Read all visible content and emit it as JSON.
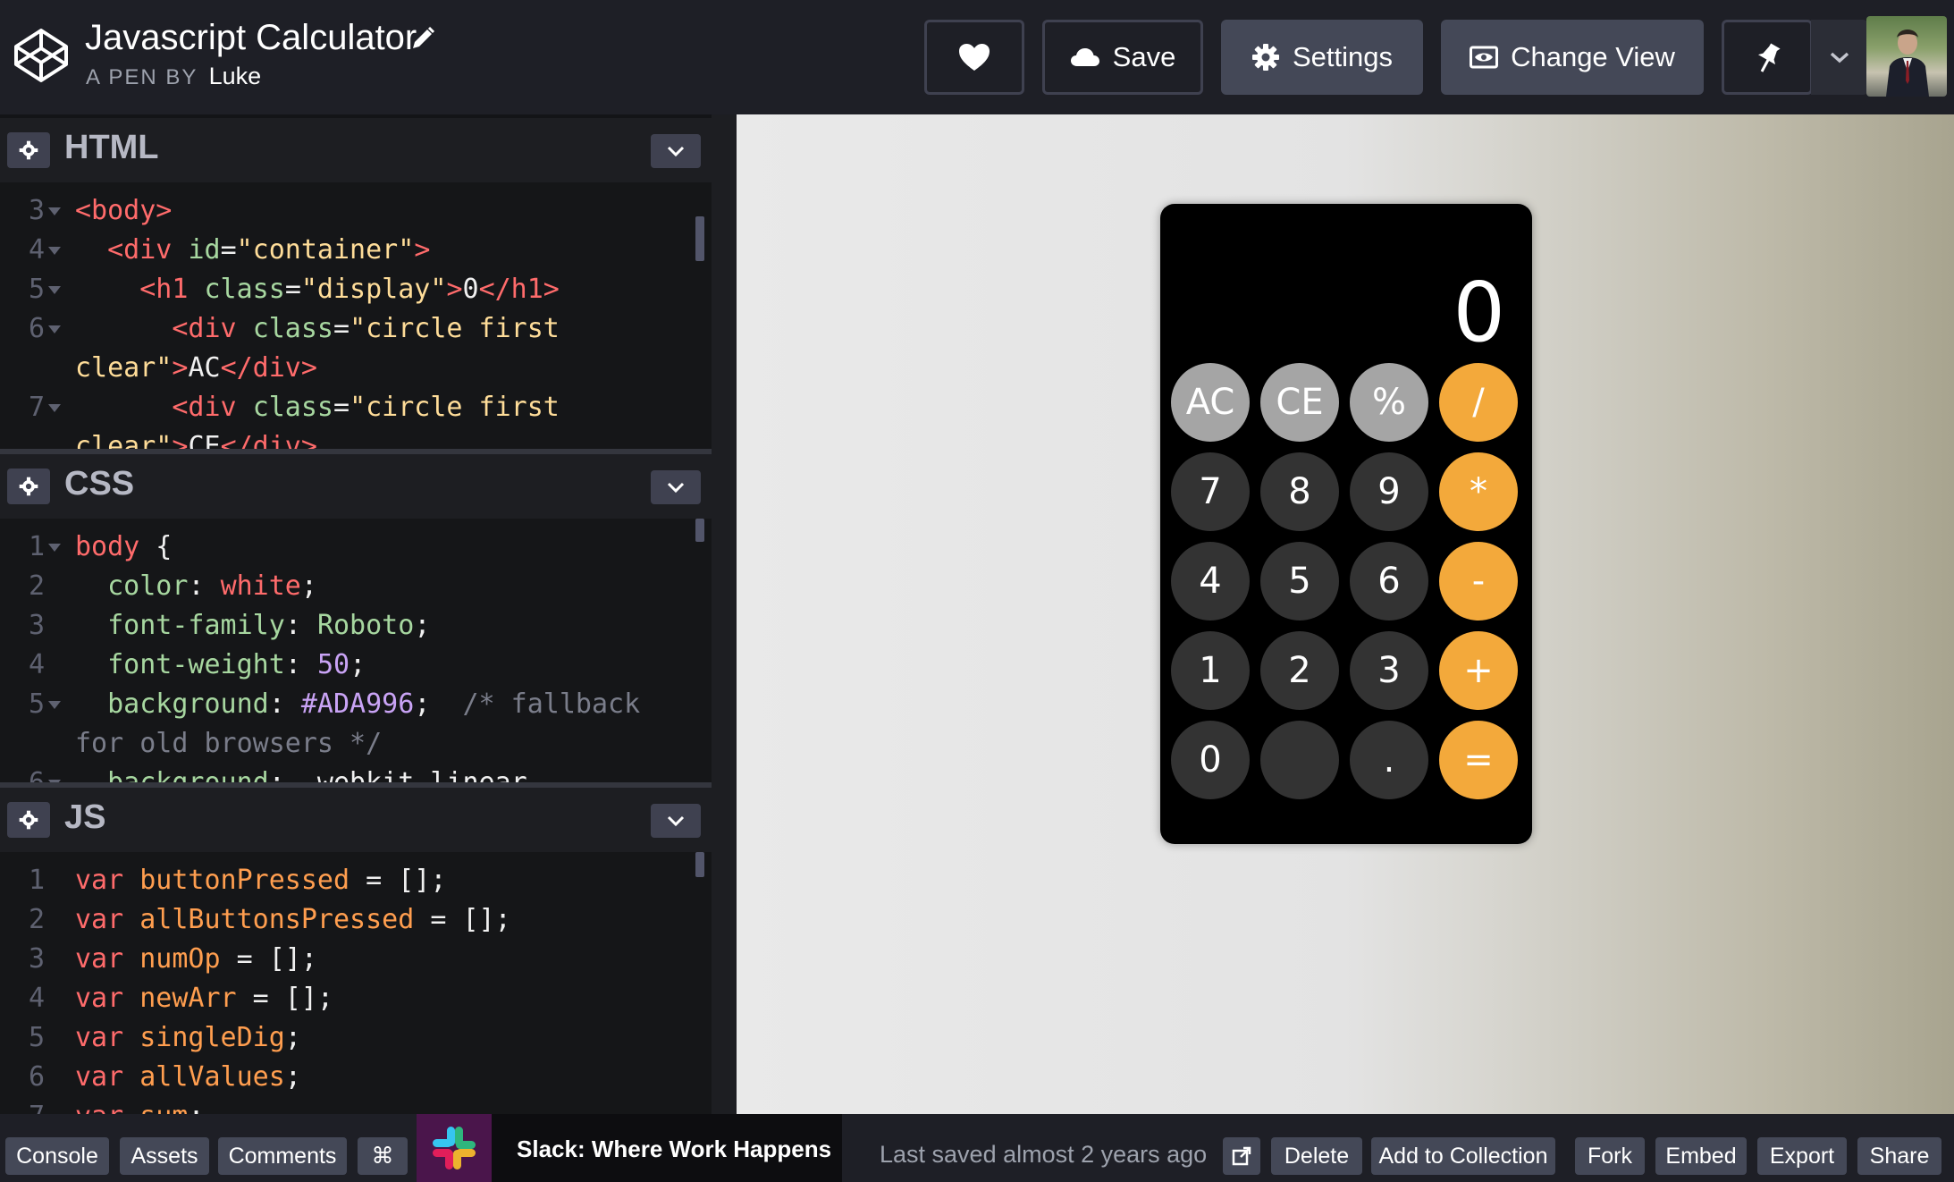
{
  "header": {
    "title": "Javascript Calculator",
    "byline_prefix": "A PEN BY",
    "author": "Luke",
    "save_label": "Save",
    "settings_label": "Settings",
    "change_view_label": "Change View"
  },
  "panels": {
    "html": {
      "title": "HTML",
      "lines": [
        {
          "n": "3",
          "fold": true,
          "parts": [
            {
              "c": "tag",
              "t": "<body>"
            }
          ]
        },
        {
          "n": "4",
          "fold": true,
          "parts": [
            {
              "c": "plain",
              "t": "  "
            },
            {
              "c": "tag",
              "t": "<div "
            },
            {
              "c": "attr",
              "t": "id"
            },
            {
              "c": "plain",
              "t": "="
            },
            {
              "c": "str",
              "t": "\"container\""
            },
            {
              "c": "tag",
              "t": ">"
            }
          ]
        },
        {
          "n": "5",
          "fold": true,
          "parts": [
            {
              "c": "plain",
              "t": "    "
            },
            {
              "c": "tag",
              "t": "<h1 "
            },
            {
              "c": "attr",
              "t": "class"
            },
            {
              "c": "plain",
              "t": "="
            },
            {
              "c": "str",
              "t": "\"display\""
            },
            {
              "c": "tag",
              "t": ">"
            },
            {
              "c": "plain",
              "t": "0"
            },
            {
              "c": "tag",
              "t": "</h1>"
            }
          ]
        },
        {
          "n": "6",
          "fold": true,
          "parts": [
            {
              "c": "plain",
              "t": "      "
            },
            {
              "c": "tag",
              "t": "<div "
            },
            {
              "c": "attr",
              "t": "class"
            },
            {
              "c": "plain",
              "t": "="
            },
            {
              "c": "str",
              "t": "\"circle first"
            }
          ]
        },
        {
          "n": "",
          "fold": false,
          "parts": [
            {
              "c": "str",
              "t": "clear\""
            },
            {
              "c": "tag",
              "t": ">"
            },
            {
              "c": "plain",
              "t": "AC"
            },
            {
              "c": "tag",
              "t": "</div>"
            }
          ]
        },
        {
          "n": "7",
          "fold": true,
          "parts": [
            {
              "c": "plain",
              "t": "      "
            },
            {
              "c": "tag",
              "t": "<div "
            },
            {
              "c": "attr",
              "t": "class"
            },
            {
              "c": "plain",
              "t": "="
            },
            {
              "c": "str",
              "t": "\"circle first"
            }
          ]
        },
        {
          "n": "",
          "fold": false,
          "parts": [
            {
              "c": "str",
              "t": "clear\""
            },
            {
              "c": "tag",
              "t": ">"
            },
            {
              "c": "plain",
              "t": "CE"
            },
            {
              "c": "tag",
              "t": "</div>"
            }
          ]
        }
      ]
    },
    "css": {
      "title": "CSS",
      "lines": [
        {
          "n": "1",
          "fold": true,
          "parts": [
            {
              "c": "sel",
              "t": "body"
            },
            {
              "c": "plain",
              "t": " {"
            }
          ]
        },
        {
          "n": "2",
          "fold": false,
          "parts": [
            {
              "c": "plain",
              "t": "  "
            },
            {
              "c": "prop",
              "t": "color"
            },
            {
              "c": "plain",
              "t": ": "
            },
            {
              "c": "val",
              "t": "white"
            },
            {
              "c": "plain",
              "t": ";"
            }
          ]
        },
        {
          "n": "3",
          "fold": false,
          "parts": [
            {
              "c": "plain",
              "t": "  "
            },
            {
              "c": "prop",
              "t": "font-family"
            },
            {
              "c": "plain",
              "t": ": "
            },
            {
              "c": "attr",
              "t": "Roboto"
            },
            {
              "c": "plain",
              "t": ";"
            }
          ]
        },
        {
          "n": "4",
          "fold": false,
          "parts": [
            {
              "c": "plain",
              "t": "  "
            },
            {
              "c": "prop",
              "t": "font-weight"
            },
            {
              "c": "plain",
              "t": ": "
            },
            {
              "c": "num",
              "t": "50"
            },
            {
              "c": "plain",
              "t": ";"
            }
          ]
        },
        {
          "n": "5",
          "fold": true,
          "parts": [
            {
              "c": "plain",
              "t": "  "
            },
            {
              "c": "prop",
              "t": "background"
            },
            {
              "c": "plain",
              "t": ": "
            },
            {
              "c": "hex",
              "t": "#ADA996"
            },
            {
              "c": "plain",
              "t": ";  "
            },
            {
              "c": "cmt",
              "t": "/* fallback"
            }
          ]
        },
        {
          "n": "",
          "fold": false,
          "parts": [
            {
              "c": "cmt",
              "t": "for old browsers */"
            }
          ]
        },
        {
          "n": "6",
          "fold": true,
          "parts": [
            {
              "c": "plain",
              "t": "  "
            },
            {
              "c": "prop",
              "t": "background"
            },
            {
              "c": "plain",
              "t": ": -webkit-linear-"
            }
          ]
        }
      ]
    },
    "js": {
      "title": "JS",
      "lines": [
        {
          "n": "1",
          "fold": false,
          "parts": [
            {
              "c": "kw",
              "t": "var "
            },
            {
              "c": "var",
              "t": "buttonPressed"
            },
            {
              "c": "op",
              "t": " = [];"
            }
          ]
        },
        {
          "n": "2",
          "fold": false,
          "parts": [
            {
              "c": "kw",
              "t": "var "
            },
            {
              "c": "var",
              "t": "allButtonsPressed"
            },
            {
              "c": "op",
              "t": " = [];"
            }
          ]
        },
        {
          "n": "3",
          "fold": false,
          "parts": [
            {
              "c": "kw",
              "t": "var "
            },
            {
              "c": "var",
              "t": "numOp"
            },
            {
              "c": "op",
              "t": " = [];"
            }
          ]
        },
        {
          "n": "4",
          "fold": false,
          "parts": [
            {
              "c": "kw",
              "t": "var "
            },
            {
              "c": "var",
              "t": "newArr"
            },
            {
              "c": "op",
              "t": " = [];"
            }
          ]
        },
        {
          "n": "5",
          "fold": false,
          "parts": [
            {
              "c": "kw",
              "t": "var "
            },
            {
              "c": "var",
              "t": "singleDig"
            },
            {
              "c": "op",
              "t": ";"
            }
          ]
        },
        {
          "n": "6",
          "fold": false,
          "parts": [
            {
              "c": "kw",
              "t": "var "
            },
            {
              "c": "var",
              "t": "allValues"
            },
            {
              "c": "op",
              "t": ";"
            }
          ]
        },
        {
          "n": "7",
          "fold": false,
          "parts": [
            {
              "c": "kw",
              "t": "var "
            },
            {
              "c": "var",
              "t": "sum"
            },
            {
              "c": "op",
              "t": ";"
            }
          ]
        }
      ]
    }
  },
  "calculator": {
    "display": "0",
    "keys": [
      {
        "label": "AC",
        "style": "light",
        "name": "key-ac"
      },
      {
        "label": "CE",
        "style": "light",
        "name": "key-ce"
      },
      {
        "label": "%",
        "style": "light",
        "name": "key-percent"
      },
      {
        "label": "/",
        "style": "orange",
        "name": "key-divide"
      },
      {
        "label": "7",
        "style": "dark",
        "name": "key-7"
      },
      {
        "label": "8",
        "style": "dark",
        "name": "key-8"
      },
      {
        "label": "9",
        "style": "dark",
        "name": "key-9"
      },
      {
        "label": "*",
        "style": "orange",
        "name": "key-multiply"
      },
      {
        "label": "4",
        "style": "dark",
        "name": "key-4"
      },
      {
        "label": "5",
        "style": "dark",
        "name": "key-5"
      },
      {
        "label": "6",
        "style": "dark",
        "name": "key-6"
      },
      {
        "label": "-",
        "style": "orange",
        "name": "key-minus"
      },
      {
        "label": "1",
        "style": "dark",
        "name": "key-1"
      },
      {
        "label": "2",
        "style": "dark",
        "name": "key-2"
      },
      {
        "label": "3",
        "style": "dark",
        "name": "key-3"
      },
      {
        "label": "+",
        "style": "orange",
        "name": "key-plus"
      },
      {
        "label": "0",
        "style": "dark",
        "name": "key-0"
      },
      {
        "label": "",
        "style": "dark",
        "name": "key-blank"
      },
      {
        "label": ".",
        "style": "dark",
        "name": "key-decimal"
      },
      {
        "label": "=",
        "style": "orange",
        "name": "key-equals"
      }
    ]
  },
  "footer": {
    "console": "Console",
    "assets": "Assets",
    "comments": "Comments",
    "shortcuts": "⌘",
    "ad_text": "Slack: Where Work Happens",
    "last_saved": "Last saved almost 2 years ago",
    "delete": "Delete",
    "add_to_collection": "Add to Collection",
    "fork": "Fork",
    "embed": "Embed",
    "export": "Export",
    "share": "Share"
  },
  "colors": {
    "header_bg": "#1e1f26",
    "button_fill": "#444857",
    "calc_orange": "#f3a93b",
    "calc_light": "#a5a5a5",
    "calc_dark": "#333333"
  }
}
